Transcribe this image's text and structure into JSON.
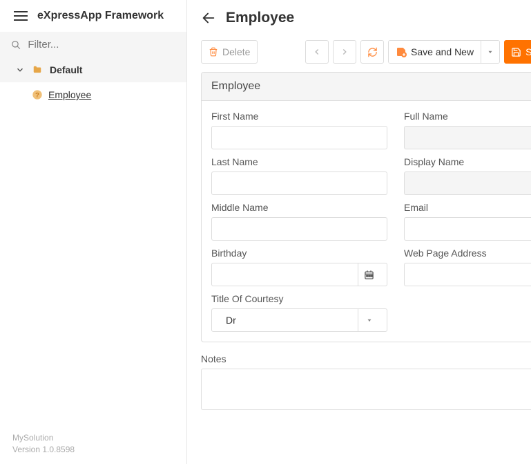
{
  "app": {
    "title": "eXpressApp Framework"
  },
  "filter": {
    "placeholder": "Filter..."
  },
  "tree": {
    "group": "Default",
    "item": "Employee"
  },
  "footer": {
    "solution": "MySolution",
    "version": "Version 1.0.8598"
  },
  "header": {
    "title": "Employee"
  },
  "toolbar": {
    "delete": "Delete",
    "save_and_new": "Save and New",
    "save": "Save"
  },
  "panel": {
    "title": "Employee"
  },
  "form": {
    "labels": {
      "first_name": "First Name",
      "full_name": "Full Name",
      "last_name": "Last Name",
      "display_name": "Display Name",
      "middle_name": "Middle Name",
      "email": "Email",
      "birthday": "Birthday",
      "web": "Web Page Address",
      "title": "Title Of Courtesy",
      "notes": "Notes"
    },
    "values": {
      "first_name": "",
      "full_name": "",
      "last_name": "",
      "display_name": "",
      "middle_name": "",
      "email": "",
      "birthday": "",
      "web": "",
      "title": "Dr",
      "notes": ""
    }
  }
}
